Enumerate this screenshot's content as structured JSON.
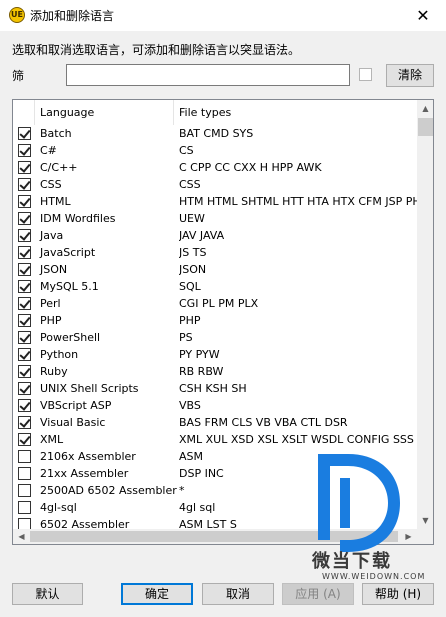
{
  "window": {
    "title": "添加和删除语言",
    "close_glyph": "✕"
  },
  "instructions": "选取和取消选取语言，可添加和删除语言以突显语法。",
  "filter": {
    "label": "筛",
    "value": "",
    "clear_button": "清除"
  },
  "table": {
    "columns": [
      "Language",
      "File types"
    ],
    "rows": [
      {
        "checked": true,
        "language": "Batch",
        "file_types": "BAT CMD SYS"
      },
      {
        "checked": true,
        "language": "C#",
        "file_types": "CS"
      },
      {
        "checked": true,
        "language": "C/C++",
        "file_types": "C CPP CC CXX H HPP AWK"
      },
      {
        "checked": true,
        "language": "CSS",
        "file_types": "CSS"
      },
      {
        "checked": true,
        "language": "HTML",
        "file_types": "HTM HTML SHTML HTT HTA HTX CFM JSP PHP PH..."
      },
      {
        "checked": true,
        "language": "IDM Wordfiles",
        "file_types": "UEW"
      },
      {
        "checked": true,
        "language": "Java",
        "file_types": "JAV JAVA"
      },
      {
        "checked": true,
        "language": "JavaScript",
        "file_types": "JS TS"
      },
      {
        "checked": true,
        "language": "JSON",
        "file_types": "JSON"
      },
      {
        "checked": true,
        "language": "MySQL 5.1",
        "file_types": "SQL"
      },
      {
        "checked": true,
        "language": "Perl",
        "file_types": "CGI PL PM PLX"
      },
      {
        "checked": true,
        "language": "PHP",
        "file_types": "PHP"
      },
      {
        "checked": true,
        "language": "PowerShell",
        "file_types": "PS"
      },
      {
        "checked": true,
        "language": "Python",
        "file_types": "PY PYW"
      },
      {
        "checked": true,
        "language": "Ruby",
        "file_types": "RB RBW"
      },
      {
        "checked": true,
        "language": "UNIX Shell Scripts",
        "file_types": "CSH KSH SH"
      },
      {
        "checked": true,
        "language": "VBScript ASP",
        "file_types": "VBS"
      },
      {
        "checked": true,
        "language": "Visual Basic",
        "file_types": "BAS FRM CLS VB VBA CTL DSR"
      },
      {
        "checked": true,
        "language": "XML",
        "file_types": "XML XUL XSD XSL XSLT WSDL CONFIG SSS"
      },
      {
        "checked": false,
        "language": "2106x Assembler",
        "file_types": "ASM"
      },
      {
        "checked": false,
        "language": "21xx Assembler",
        "file_types": "DSP INC"
      },
      {
        "checked": false,
        "language": "2500AD 6502 Assembler",
        "file_types": "*"
      },
      {
        "checked": false,
        "language": "4gl-sql",
        "file_types": "4gl sql"
      },
      {
        "checked": false,
        "language": "6502 Assembler",
        "file_types": "ASM LST S"
      }
    ]
  },
  "buttons": {
    "default": "默认",
    "ok": "确定",
    "cancel": "取消",
    "apply": "应用 (A)",
    "help": "帮助 (H)"
  },
  "watermark": {
    "brand": "微当下载",
    "url": "WWW.WEIDOWN.COM",
    "color": "#1a7de0"
  },
  "colors": {
    "accent": "#0078d7",
    "logo_blue": "#1a7de0"
  }
}
